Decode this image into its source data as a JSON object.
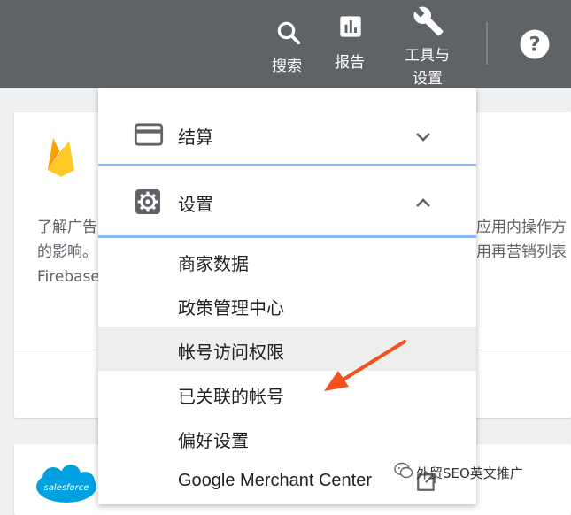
{
  "topbar": {
    "search_label": "搜索",
    "reports_label": "报告",
    "tools_label_line1": "工具与",
    "tools_label_line2": "设置",
    "help_icon": "help-icon"
  },
  "cards": {
    "firebase_text_line1": "了解广告",
    "firebase_text_line2": "的影响。",
    "firebase_text_line3": "Firebase",
    "right_text_line1": "应用内操作方",
    "right_text_line2": "用再营销列表",
    "salesforce_logo_text": "salesforce"
  },
  "menu": {
    "billing_label": "结算",
    "settings_label": "设置",
    "items": [
      {
        "label": "商家数据"
      },
      {
        "label": "政策管理中心"
      },
      {
        "label": "帐号访问权限"
      },
      {
        "label": "已关联的帐号"
      },
      {
        "label": "偏好设置"
      },
      {
        "label": "Google Merchant Center"
      }
    ],
    "active_index": 2
  },
  "watermark": {
    "text": "外贸SEO英文推广"
  },
  "colors": {
    "topbar": "#5f6368",
    "accent_rule": "#8ab4f8",
    "arrow": "#f4511e",
    "firebase_yellow": "#ffca28",
    "salesforce_blue": "#00a1e0"
  }
}
